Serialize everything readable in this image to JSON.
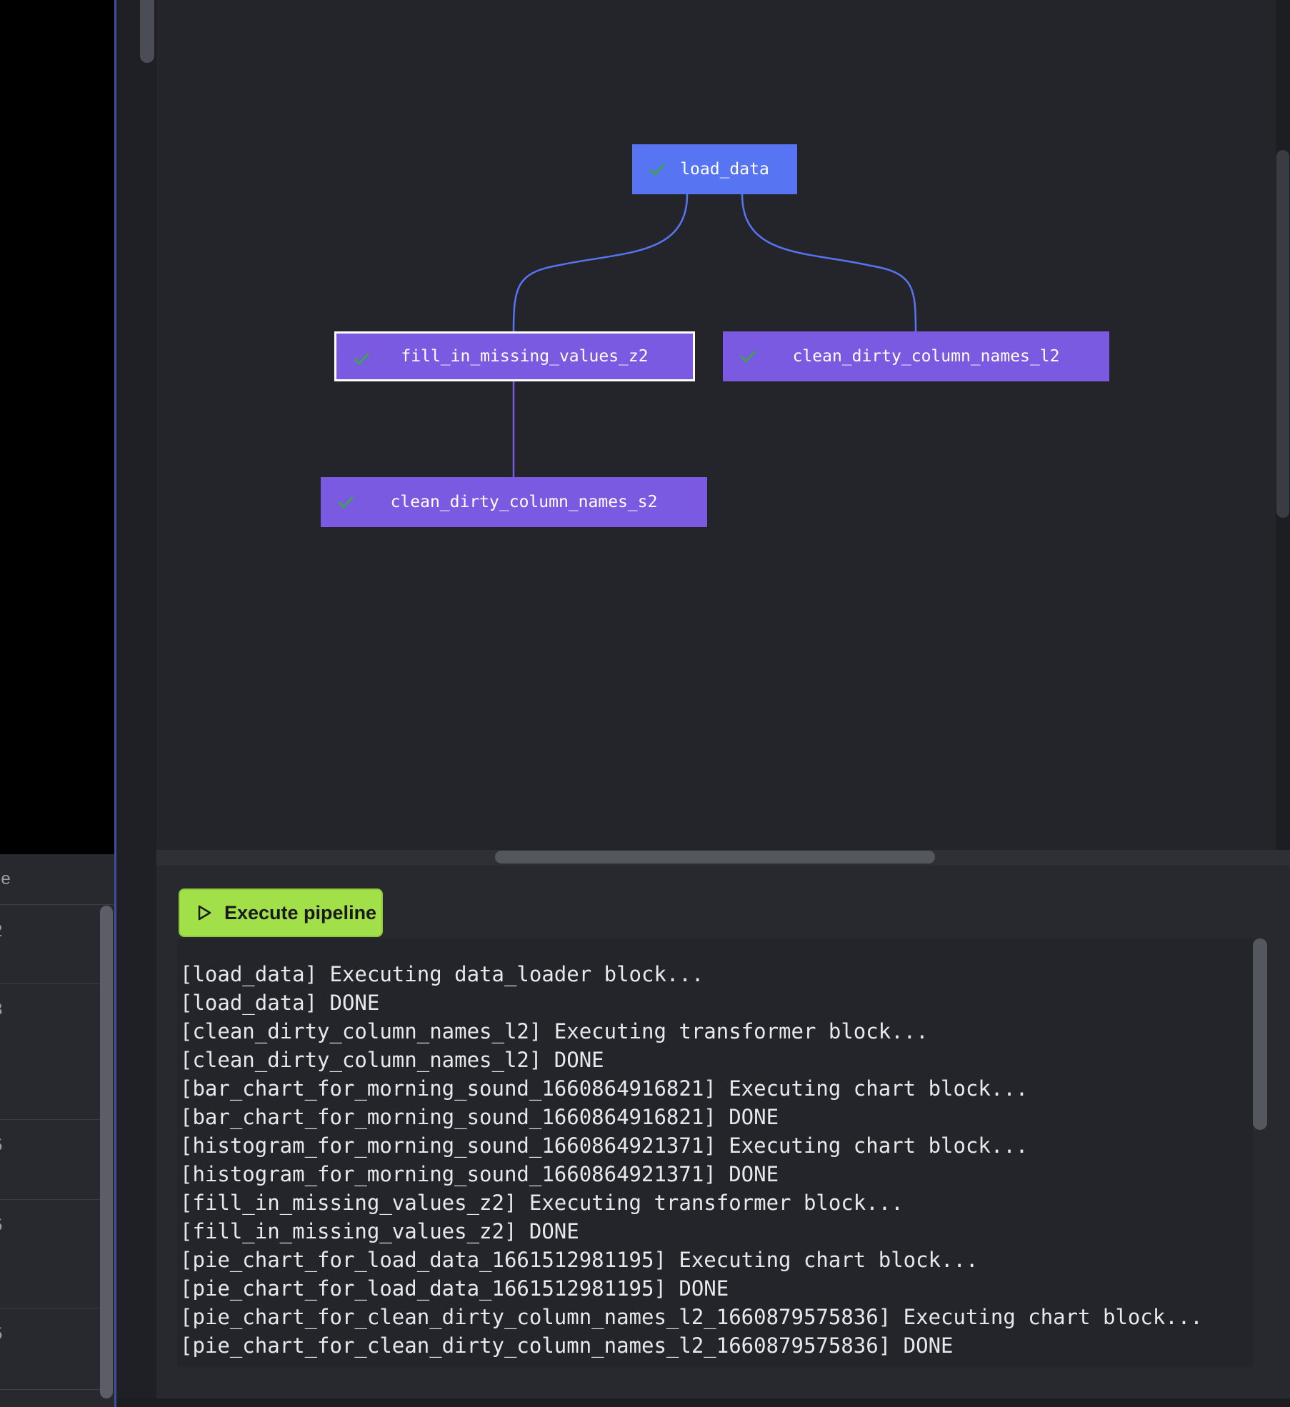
{
  "sidebar": {
    "header_fragment": "ge",
    "row_fragments": [
      "2",
      "3",
      "5",
      "5",
      "5"
    ]
  },
  "graph": {
    "nodes": [
      {
        "id": "load_data",
        "label": "load_data",
        "type": "data_loader",
        "status": "success"
      },
      {
        "id": "fill_in_missing_values_z2",
        "label": "fill_in_missing_values_z2",
        "type": "transformer",
        "status": "success",
        "selected": true
      },
      {
        "id": "clean_dirty_column_names_l2",
        "label": "clean_dirty_column_names_l2",
        "type": "transformer",
        "status": "success"
      },
      {
        "id": "clean_dirty_column_names_s2",
        "label": "clean_dirty_column_names_s2",
        "type": "transformer",
        "status": "success"
      }
    ],
    "edges": [
      {
        "from": "load_data",
        "to": "fill_in_missing_values_z2"
      },
      {
        "from": "load_data",
        "to": "clean_dirty_column_names_l2"
      },
      {
        "from": "fill_in_missing_values_z2",
        "to": "clean_dirty_column_names_s2"
      }
    ],
    "colors": {
      "data_loader": "#5774f2",
      "transformer": "#7a5ae0",
      "edge_loader": "#5774f2",
      "edge_transformer": "#7a5ae0",
      "check": "#3fa34d"
    }
  },
  "execute": {
    "label": "Execute pipeline",
    "accent": "#a2e04a"
  },
  "log": [
    "[load_data] Executing data_loader block...",
    "[load_data] DONE",
    "[clean_dirty_column_names_l2] Executing transformer block...",
    "[clean_dirty_column_names_l2] DONE",
    "[bar_chart_for_morning_sound_1660864916821] Executing chart block...",
    "[bar_chart_for_morning_sound_1660864916821] DONE",
    "[histogram_for_morning_sound_1660864921371] Executing chart block...",
    "[histogram_for_morning_sound_1660864921371] DONE",
    "[fill_in_missing_values_z2] Executing transformer block...",
    "[fill_in_missing_values_z2] DONE",
    "[pie_chart_for_load_data_1661512981195] Executing chart block...",
    "[pie_chart_for_load_data_1661512981195] DONE",
    "[pie_chart_for_clean_dirty_column_names_l2_1660879575836] Executing chart block...",
    "[pie_chart_for_clean_dirty_column_names_l2_1660879575836] DONE"
  ]
}
